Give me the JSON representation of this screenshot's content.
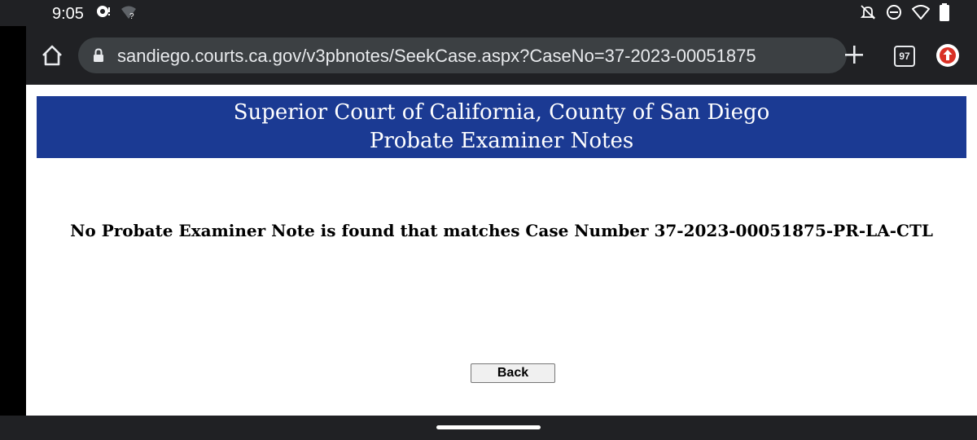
{
  "status_bar": {
    "time": "9:05",
    "left_icons": [
      "chat-bubble-icon",
      "wifi-question-icon"
    ],
    "right_icons": [
      "notifications-off-icon",
      "do-not-disturb-icon",
      "wifi-icon",
      "battery-icon"
    ]
  },
  "browser": {
    "url": "sandiego.courts.ca.gov/v3pbnotes/SeekCase.aspx?CaseNo=37-2023-00051875",
    "tab_count": "97",
    "icons": [
      "home-icon",
      "lock-icon",
      "plus-icon",
      "tab-switcher-icon",
      "update-icon"
    ]
  },
  "page": {
    "banner_line1": "Superior Court of California, County of San Diego",
    "banner_line2": "Probate Examiner Notes",
    "message": "No Probate Examiner Note is found that matches Case Number 37-2023-00051875-PR-LA-CTL",
    "back_label": "Back"
  },
  "colors": {
    "banner_bg": "#1b3a93",
    "chrome_bg": "#202124",
    "omnibox_bg": "#3c4043"
  }
}
